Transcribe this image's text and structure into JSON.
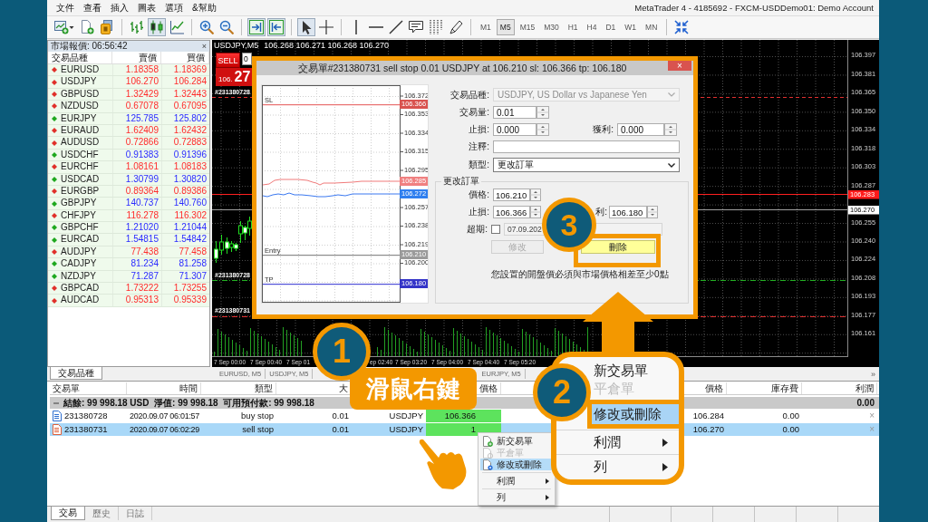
{
  "window": {
    "title": "MetaTrader 4 - 4185692 - FXCM-USDDemo01: Demo Account"
  },
  "menu": [
    "文件",
    "查看",
    "插入",
    "圖表",
    "選項",
    "&幫助"
  ],
  "toolbar": {
    "tool_groups": [
      [
        {
          "kind": "new_chart",
          "pressed": false
        },
        {
          "kind": "new_document",
          "pressed": false
        },
        {
          "kind": "market",
          "pressed": false
        }
      ],
      [
        {
          "kind": "bar_chart",
          "pressed": false
        },
        {
          "kind": "candlesticks",
          "pressed": true
        },
        {
          "kind": "line_chart",
          "pressed": false
        }
      ],
      [
        {
          "kind": "zoom_in",
          "pressed": false
        },
        {
          "kind": "zoom_out",
          "pressed": false
        }
      ],
      [
        {
          "kind": "auto_scroll",
          "pressed": true
        },
        {
          "kind": "chart_shift",
          "pressed": true
        }
      ],
      [
        {
          "kind": "cursor",
          "pressed": true
        },
        {
          "kind": "crosshair",
          "pressed": false
        }
      ],
      [
        {
          "kind": "vertical_line",
          "pressed": false
        },
        {
          "kind": "horizontal_line",
          "pressed": false
        },
        {
          "kind": "trend_line",
          "pressed": false
        },
        {
          "kind": "speech_bubble",
          "pressed": false
        },
        {
          "kind": "dotted_bars",
          "pressed": false
        },
        {
          "kind": "letters",
          "pressed": false
        }
      ]
    ],
    "timeframes": [
      {
        "label": "M1",
        "selected": false
      },
      {
        "label": "M5",
        "selected": true
      },
      {
        "label": "M15",
        "selected": false
      },
      {
        "label": "M30",
        "selected": false
      },
      {
        "label": "H1",
        "selected": false
      },
      {
        "label": "H4",
        "selected": false
      },
      {
        "label": "D1",
        "selected": false
      },
      {
        "label": "W1",
        "selected": false
      },
      {
        "label": "MN",
        "selected": false
      }
    ],
    "end_tools": [
      {
        "kind": "arrows_in",
        "pressed": false
      }
    ]
  },
  "market_watch": {
    "title": "市場報價: 06:56:42",
    "close": "×",
    "columns": [
      "交易品種",
      "賣價",
      "買價"
    ],
    "rows": [
      {
        "symbol": "EURUSD",
        "bid": "1.18358",
        "ask": "1.18369",
        "rising": false
      },
      {
        "symbol": "USDJPY",
        "bid": "106.270",
        "ask": "106.284",
        "rising": false
      },
      {
        "symbol": "GBPUSD",
        "bid": "1.32429",
        "ask": "1.32443",
        "rising": false
      },
      {
        "symbol": "NZDUSD",
        "bid": "0.67078",
        "ask": "0.67095",
        "rising": false
      },
      {
        "symbol": "EURJPY",
        "bid": "125.785",
        "ask": "125.802",
        "rising": true
      },
      {
        "symbol": "EURAUD",
        "bid": "1.62409",
        "ask": "1.62432",
        "rising": false
      },
      {
        "symbol": "AUDUSD",
        "bid": "0.72866",
        "ask": "0.72883",
        "rising": false
      },
      {
        "symbol": "USDCHF",
        "bid": "0.91383",
        "ask": "0.91396",
        "rising": true
      },
      {
        "symbol": "EURCHF",
        "bid": "1.08161",
        "ask": "1.08183",
        "rising": false
      },
      {
        "symbol": "USDCAD",
        "bid": "1.30799",
        "ask": "1.30820",
        "rising": true
      },
      {
        "symbol": "EURGBP",
        "bid": "0.89364",
        "ask": "0.89386",
        "rising": false
      },
      {
        "symbol": "GBPJPY",
        "bid": "140.737",
        "ask": "140.760",
        "rising": true
      },
      {
        "symbol": "CHFJPY",
        "bid": "116.278",
        "ask": "116.302",
        "rising": false
      },
      {
        "symbol": "GBPCHF",
        "bid": "1.21020",
        "ask": "1.21044",
        "rising": true
      },
      {
        "symbol": "EURCAD",
        "bid": "1.54815",
        "ask": "1.54842",
        "rising": true
      },
      {
        "symbol": "AUDJPY",
        "bid": "77.438",
        "ask": "77.458",
        "rising": false
      },
      {
        "symbol": "CADJPY",
        "bid": "81.234",
        "ask": "81.258",
        "rising": true
      },
      {
        "symbol": "NZDJPY",
        "bid": "71.287",
        "ask": "71.307",
        "rising": true
      },
      {
        "symbol": "GBPCAD",
        "bid": "1.73222",
        "ask": "1.73255",
        "rising": false
      },
      {
        "symbol": "AUDCAD",
        "bid": "0.95313",
        "ask": "0.95339",
        "rising": false
      }
    ],
    "tabs": [
      {
        "label": "交易品種",
        "selected": true
      }
    ]
  },
  "chart": {
    "symbol": "USDJPY,M5",
    "quote": "106.268 106.271 106.268 106.270",
    "sell_label": "SELL",
    "sell_price_head": "106.",
    "sell_price_big": "27",
    "lot": "0",
    "order_labels": [
      "#231380728",
      "#231380728",
      "#231380731"
    ],
    "price_axis": [
      "106.397",
      "106.381",
      "106.365",
      "106.350",
      "106.334",
      "106.318",
      "106.303",
      "106.287",
      "106.255",
      "106.240",
      "106.224",
      "106.208",
      "106.193",
      "106.177",
      "106.161"
    ],
    "ask_tag": "106.283",
    "bid_tag": "106.270",
    "time_axis": [
      "7 Sep 00:00",
      "7 Sep 00:40",
      "7 Sep 01",
      "ep 02:40",
      "7 Sep 03:20",
      "7 Sep 04:00",
      "7 Sep 04:40",
      "7 Sep 05:20"
    ],
    "tabs": [
      {
        "label": "EURUSD, M5",
        "selected": false
      },
      {
        "label": "USDJPY, M5",
        "selected": false
      },
      {
        "label": "EURJPY, M5",
        "selected": false
      }
    ],
    "tab_scroll": "»"
  },
  "dialog": {
    "title": "交易單#231380731 sell stop 0.01 USDJPY at 106.210 sl: 106.366 tp: 106.180",
    "close": "×",
    "preview": {
      "scale": [
        "106.372",
        "106.353",
        "106.334",
        "106.315",
        "106.295",
        "106.257",
        "106.238",
        "106.219",
        "106.200"
      ],
      "tags": [
        {
          "label": "106.366",
          "color": "#d9534f"
        },
        {
          "label": "106.285",
          "color": "#f08080"
        },
        {
          "label": "106.272",
          "color": "#2f7fef"
        },
        {
          "label": "106.210",
          "color": "#9a9a9a"
        },
        {
          "label": "106.180",
          "color": "#3434c8"
        }
      ],
      "lines": [
        {
          "label": "SL",
          "color": "#e87070"
        },
        {
          "label": "Entry",
          "color": "#8a8a8a"
        },
        {
          "label": "TP",
          "color": "#5050d8"
        }
      ]
    },
    "symbol": {
      "label": "交易品種:",
      "value": "USDJPY, US Dollar vs Japanese Yen",
      "disabled": true
    },
    "volume": {
      "label": "交易量:",
      "value": "0.01"
    },
    "stop_loss": {
      "label": "止損:",
      "value": "0.000"
    },
    "take_profit": {
      "label": "獲利:",
      "value": "0.000"
    },
    "comment": {
      "label": "注釋:"
    },
    "order_type": {
      "label": "類型:",
      "value": "更改訂單"
    },
    "modify": {
      "title": "更改訂單",
      "price": {
        "label": "價格:",
        "value": "106.210"
      },
      "stop_loss": {
        "label": "止損:",
        "value": "106.366"
      },
      "take_profit": {
        "label": "利:",
        "value": "106.180"
      },
      "expiry": {
        "label": "超期:",
        "checked": false,
        "value": "07.09.202"
      },
      "buttons": [
        {
          "label": "修改",
          "kind": "modify",
          "disabled": true
        },
        {
          "label": "刪除",
          "kind": "delete",
          "disabled": false
        }
      ],
      "note": "您設置的開盤價必須與市場價格相差至少0點"
    }
  },
  "terminal": {
    "columns": [
      "交易單",
      "時間",
      "類型",
      "大",
      "價格",
      "價格",
      "庫存費",
      "利潤"
    ],
    "summary": {
      "text": "結餘: 99 998.18 USD  淨值: 99 998.18  可用預付款: 99 998.18",
      "profit": "0.00",
      "expanded": true
    },
    "rows": [
      {
        "ticket": "231380728",
        "time": "2020.09.07 06:01:57",
        "type": "buy stop",
        "size": "0.01",
        "symbol": "USDJPY",
        "price": "106.366",
        "market_price": "106.284",
        "swap": "0.00",
        "close": "×",
        "kind": "buy",
        "highlighted": true,
        "selected": false
      },
      {
        "ticket": "231380731",
        "time": "2020.09.07 06:02:29",
        "type": "sell stop",
        "size": "0.01",
        "symbol": "USDJPY",
        "price": "1",
        "market_price": "106.270",
        "swap": "0.00",
        "close": "×",
        "kind": "sell",
        "highlighted": true,
        "selected": true
      }
    ],
    "tabs": [
      {
        "label": "交易",
        "selected": true
      },
      {
        "label": "歷史",
        "selected": false
      },
      {
        "label": "日誌",
        "selected": false
      }
    ]
  },
  "context_menu": {
    "items": [
      {
        "label": "新交易單",
        "kind": "new",
        "disabled": false,
        "selected": false
      },
      {
        "label": "平倉單",
        "kind": "close",
        "disabled": true,
        "selected": false
      },
      {
        "label": "修改或刪除",
        "kind": "modify",
        "disabled": false,
        "selected": true
      },
      {
        "label": "利潤",
        "kind": "submenu",
        "disabled": false,
        "selected": false
      },
      {
        "label": "列",
        "kind": "submenu",
        "disabled": false,
        "selected": false
      }
    ]
  },
  "callout": {
    "items": [
      {
        "label": "新交易單",
        "kind": "action",
        "disabled": false,
        "selected": false
      },
      {
        "label": "平倉單",
        "kind": "action",
        "disabled": true,
        "selected": false
      },
      {
        "label": "修改或刪除",
        "kind": "action",
        "disabled": false,
        "selected": true
      },
      {
        "label": "利潤",
        "kind": "submenu",
        "disabled": false,
        "selected": false
      },
      {
        "label": "列",
        "kind": "submenu",
        "disabled": false,
        "selected": false
      }
    ]
  },
  "annotations": {
    "steps": [
      "1",
      "2",
      "3"
    ],
    "caption": "滑鼠右鍵"
  }
}
